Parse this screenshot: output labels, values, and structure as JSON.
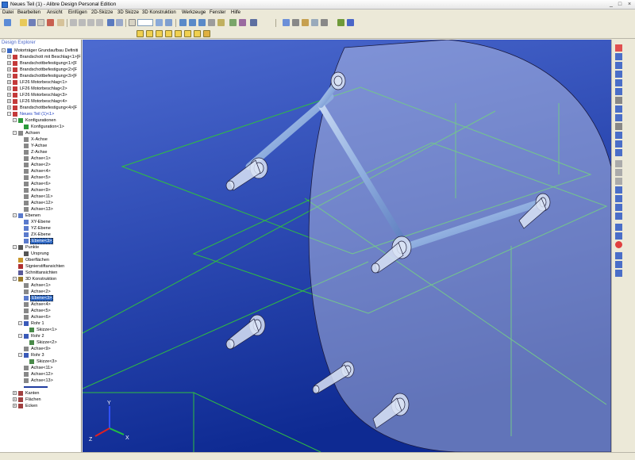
{
  "window": {
    "title": "Neues Teil (1) - Alibre Design Personal Edition"
  },
  "menu": [
    "Datei",
    "Bearbeiten",
    "Ansicht",
    "Einfügen",
    "2D-Skizze",
    "3D Skizze",
    "3D Konstruktion",
    "Werkzeuge",
    "Fenster",
    "Hilfe"
  ],
  "explorer": {
    "header": "Design Explorer",
    "items": [
      {
        "label": "Motorträger Grundaufbau Definiti",
        "depth": 0,
        "exp": "-",
        "icon": "assembly-icon",
        "sel": false
      },
      {
        "label": "Brandschott mit Beschlag<1>[F",
        "depth": 1,
        "exp": "+",
        "icon": "part-icon",
        "sel": false
      },
      {
        "label": "Brandschottbefestigung<1>[F",
        "depth": 1,
        "exp": "+",
        "icon": "part-icon",
        "sel": false
      },
      {
        "label": "Brandschottbefestigung<2>[F",
        "depth": 1,
        "exp": "+",
        "icon": "part-icon",
        "sel": false
      },
      {
        "label": "Brandschottbefestigung<3>[F",
        "depth": 1,
        "exp": "+",
        "icon": "part-icon",
        "sel": false
      },
      {
        "label": "LF26 Motorbeschlag<1>",
        "depth": 1,
        "exp": "+",
        "icon": "part-icon",
        "sel": false
      },
      {
        "label": "LF26 Motorbeschlag<2>",
        "depth": 1,
        "exp": "+",
        "icon": "part-icon",
        "sel": false
      },
      {
        "label": "LF26 Motorbeschlag<3>",
        "depth": 1,
        "exp": "+",
        "icon": "part-icon",
        "sel": false
      },
      {
        "label": "LF26 Motorbeschlag<4>",
        "depth": 1,
        "exp": "+",
        "icon": "part-icon",
        "sel": false
      },
      {
        "label": "Brandschottbefestigung<4>[F",
        "depth": 1,
        "exp": "+",
        "icon": "part-icon",
        "sel": false
      },
      {
        "label": "Neues Teil (1)<1>",
        "depth": 1,
        "exp": "-",
        "icon": "part-icon",
        "sel": false,
        "blue": true
      },
      {
        "label": "Konfigurationen",
        "depth": 2,
        "exp": "-",
        "icon": "config-icon",
        "sel": false
      },
      {
        "label": "Konfiguration<1>",
        "depth": 3,
        "exp": "",
        "icon": "config-icon",
        "sel": false
      },
      {
        "label": "Achsen",
        "depth": 2,
        "exp": "-",
        "icon": "axis-icon",
        "sel": false
      },
      {
        "label": "X-Achse",
        "depth": 3,
        "exp": "",
        "icon": "axis-icon",
        "sel": false
      },
      {
        "label": "Y-Achse",
        "depth": 3,
        "exp": "",
        "icon": "axis-icon",
        "sel": false
      },
      {
        "label": "Z-Achse",
        "depth": 3,
        "exp": "",
        "icon": "axis-icon",
        "sel": false
      },
      {
        "label": "Achse<1>",
        "depth": 3,
        "exp": "",
        "icon": "axis-icon",
        "sel": false
      },
      {
        "label": "Achse<2>",
        "depth": 3,
        "exp": "",
        "icon": "axis-icon",
        "sel": false
      },
      {
        "label": "Achse<4>",
        "depth": 3,
        "exp": "",
        "icon": "axis-icon",
        "sel": false
      },
      {
        "label": "Achse<5>",
        "depth": 3,
        "exp": "",
        "icon": "axis-icon",
        "sel": false
      },
      {
        "label": "Achse<6>",
        "depth": 3,
        "exp": "",
        "icon": "axis-icon",
        "sel": false
      },
      {
        "label": "Achse<9>",
        "depth": 3,
        "exp": "",
        "icon": "axis-icon",
        "sel": false
      },
      {
        "label": "Achse<11>",
        "depth": 3,
        "exp": "",
        "icon": "axis-icon",
        "sel": false
      },
      {
        "label": "Achse<12>",
        "depth": 3,
        "exp": "",
        "icon": "axis-icon",
        "sel": false
      },
      {
        "label": "Achse<13>",
        "depth": 3,
        "exp": "",
        "icon": "axis-icon",
        "sel": false
      },
      {
        "label": "Ebenen",
        "depth": 2,
        "exp": "-",
        "icon": "plane-icon",
        "sel": false
      },
      {
        "label": "XY-Ebene",
        "depth": 3,
        "exp": "",
        "icon": "plane-icon",
        "sel": false
      },
      {
        "label": "YZ-Ebene",
        "depth": 3,
        "exp": "",
        "icon": "plane-icon",
        "sel": false
      },
      {
        "label": "ZX-Ebene",
        "depth": 3,
        "exp": "",
        "icon": "plane-icon",
        "sel": false
      },
      {
        "label": "Ebene<3>",
        "depth": 3,
        "exp": "",
        "icon": "plane-icon",
        "sel": true
      },
      {
        "label": "Punkte",
        "depth": 2,
        "exp": "-",
        "icon": "point-icon",
        "sel": false
      },
      {
        "label": "Ursprung",
        "depth": 3,
        "exp": "",
        "icon": "point-icon",
        "sel": false
      },
      {
        "label": "Oberflächen",
        "depth": 2,
        "exp": "",
        "icon": "surface-icon",
        "sel": false
      },
      {
        "label": "Signierstiftansichten",
        "depth": 2,
        "exp": "",
        "icon": "pen-icon",
        "sel": false
      },
      {
        "label": "Schnittansichten",
        "depth": 2,
        "exp": "",
        "icon": "section-icon",
        "sel": false
      },
      {
        "label": "3D Konstruktion",
        "depth": 2,
        "exp": "-",
        "icon": "construction-icon",
        "sel": false
      },
      {
        "label": "Achse<1>",
        "depth": 3,
        "exp": "",
        "icon": "axis-icon",
        "sel": false
      },
      {
        "label": "Achse<2>",
        "depth": 3,
        "exp": "",
        "icon": "axis-icon",
        "sel": false
      },
      {
        "label": "Ebene<3>",
        "depth": 3,
        "exp": "",
        "icon": "plane-icon",
        "sel": true
      },
      {
        "label": "Achse<4>",
        "depth": 3,
        "exp": "",
        "icon": "axis-icon",
        "sel": false
      },
      {
        "label": "Achse<5>",
        "depth": 3,
        "exp": "",
        "icon": "axis-icon",
        "sel": false
      },
      {
        "label": "Achse<6>",
        "depth": 3,
        "exp": "",
        "icon": "axis-icon",
        "sel": false
      },
      {
        "label": "Rohr 1",
        "depth": 3,
        "exp": "-",
        "icon": "sweep-icon",
        "sel": false
      },
      {
        "label": "Skizze<1>",
        "depth": 4,
        "exp": "",
        "icon": "sketch-icon",
        "sel": false
      },
      {
        "label": "Rohr 2",
        "depth": 3,
        "exp": "-",
        "icon": "sweep-icon",
        "sel": false
      },
      {
        "label": "Skizze<2>",
        "depth": 4,
        "exp": "",
        "icon": "sketch-icon",
        "sel": false
      },
      {
        "label": "Achse<9>",
        "depth": 3,
        "exp": "",
        "icon": "axis-icon",
        "sel": false
      },
      {
        "label": "Rohr 3",
        "depth": 3,
        "exp": "-",
        "icon": "sweep-icon",
        "sel": false
      },
      {
        "label": "Skizze<3>",
        "depth": 4,
        "exp": "",
        "icon": "sketch-icon",
        "sel": false
      },
      {
        "label": "Achse<11>",
        "depth": 3,
        "exp": "",
        "icon": "axis-icon",
        "sel": false
      },
      {
        "label": "Achse<12>",
        "depth": 3,
        "exp": "",
        "icon": "axis-icon",
        "sel": false
      },
      {
        "label": "Achse<13>",
        "depth": 3,
        "exp": "",
        "icon": "axis-icon",
        "sel": false
      },
      {
        "label": "",
        "depth": 3,
        "exp": "",
        "icon": "rollback-bar-icon",
        "sel": false
      },
      {
        "label": "Kanten",
        "depth": 2,
        "exp": "+",
        "icon": "edges-icon",
        "sel": false
      },
      {
        "label": "Flächen",
        "depth": 2,
        "exp": "+",
        "icon": "faces-icon",
        "sel": false
      },
      {
        "label": "Ecken",
        "depth": 2,
        "exp": "+",
        "icon": "vertices-icon",
        "sel": false
      }
    ]
  },
  "viewport": {
    "background_top": "#4b63c8",
    "background_bottom": "#0a2a8c",
    "triad": {
      "x_label": "X",
      "y_label": "Y",
      "z_label": "Z"
    }
  },
  "colors": {
    "selection": "#316ac5",
    "plane_edges": "#2fbf3f",
    "tube": "#9fb9e4"
  }
}
